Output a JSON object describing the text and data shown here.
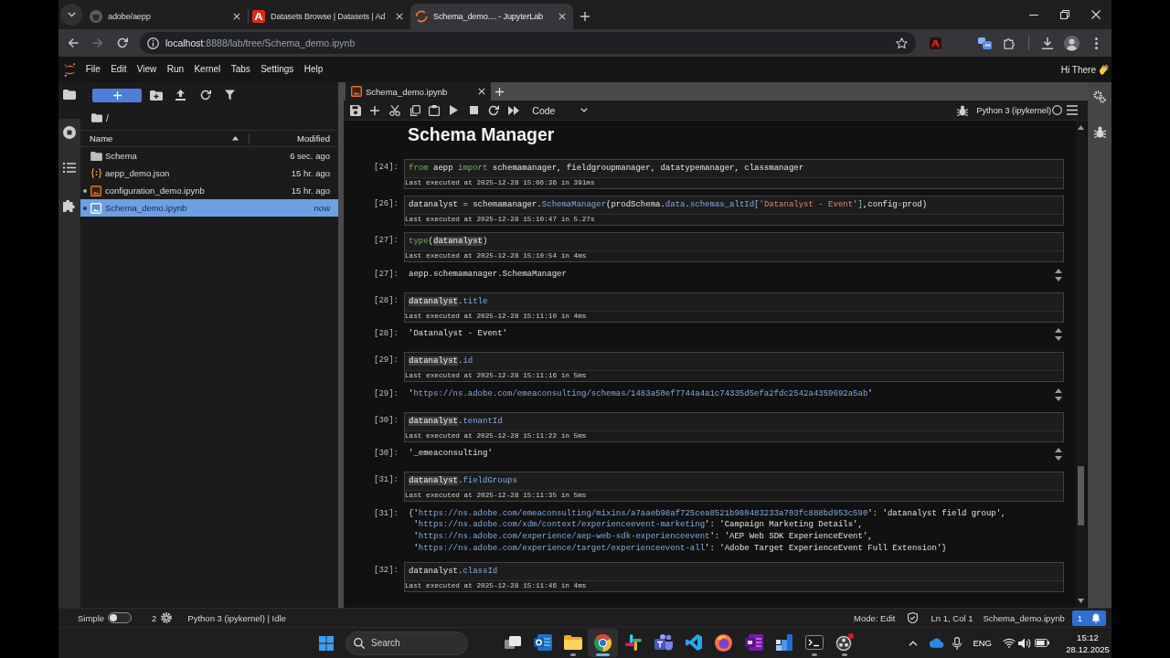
{
  "browser": {
    "tabs": [
      {
        "kind": "repo",
        "title": "adobe/aepp",
        "selected": false
      },
      {
        "kind": "cloud",
        "title": "Datasets Browse | Datasets | Ad",
        "selected": false
      },
      {
        "kind": "lab",
        "title": "Schema_demo.... - JupyterLab",
        "selected": true
      }
    ],
    "forward_disabled": true,
    "address": {
      "host": "localhost",
      "path": ":8888/lab/tree/Schema_demo.ipynb"
    }
  },
  "menu_bar": {
    "items": [
      "File",
      "Edit",
      "View",
      "Run",
      "Kernel",
      "Tabs",
      "Settings",
      "Help"
    ],
    "greeting": "Hi There"
  },
  "left_sidebar": {
    "items": [
      {
        "kind": "files",
        "selected": true
      },
      {
        "kind": "running",
        "selected": false
      },
      {
        "kind": "toc",
        "selected": false
      },
      {
        "kind": "extensions",
        "selected": false
      }
    ]
  },
  "file_browser": {
    "path": "/",
    "columns": [
      "Name",
      "Modified"
    ],
    "items": [
      {
        "kind": "folder",
        "name": "Schema",
        "modified": "6 sec. ago",
        "running": false,
        "selected": false
      },
      {
        "kind": "json",
        "name": "aepp_demo.json",
        "modified": "15 hr. ago",
        "running": false,
        "selected": false
      },
      {
        "kind": "notebook",
        "name": "configuration_demo.ipynb",
        "modified": "15 hr. ago",
        "running": true,
        "selected": false
      },
      {
        "kind": "notebook",
        "name": "Schema_demo.ipynb",
        "modified": "now",
        "running": true,
        "selected": true
      }
    ]
  },
  "notebook": {
    "tabs": [
      {
        "title": "Schema_demo.ipynb",
        "selected": true
      }
    ],
    "cell_type": "Code",
    "kernel": "Python 3 (ipykernel)",
    "kernel_busy": false,
    "heading": "Schema Manager",
    "cells": [
      {
        "prompt": "[24]:",
        "code": [
          {
            "kind": "keyword",
            "text": "from"
          },
          {
            "kind": "plain",
            "text": " aepp "
          },
          {
            "kind": "keyword",
            "text": "import"
          },
          {
            "kind": "plain",
            "text": " schemamanager, fieldgroupmanager, datatypemanager, classmanager"
          }
        ],
        "executed": "Last executed at 2025-12-28 15:06:36 in 391ms"
      },
      {
        "prompt": "[26]:",
        "code": [
          {
            "kind": "plain",
            "text": "datanalyst = schemamanager."
          },
          {
            "kind": "attribute",
            "text": "SchemaManager"
          },
          {
            "kind": "plain",
            "text": "(prodSchema."
          },
          {
            "kind": "attribute",
            "text": "data"
          },
          {
            "kind": "plain",
            "text": "."
          },
          {
            "kind": "attribute",
            "text": "schemas_altId"
          },
          {
            "kind": "bracket",
            "text": "["
          },
          {
            "kind": "string",
            "text": "'Datanalyst - Event'"
          },
          {
            "kind": "bracket",
            "text": "]"
          },
          {
            "kind": "plain",
            "text": ",config"
          },
          {
            "kind": "operator",
            "text": "="
          },
          {
            "kind": "plain",
            "text": "prod)"
          }
        ],
        "executed": "Last executed at 2025-12-28 15:10:47 in 5.27s"
      },
      {
        "prompt": "[27]:",
        "code": [
          {
            "kind": "builtin",
            "text": "type"
          },
          {
            "kind": "plain",
            "text": "("
          },
          {
            "kind": "match",
            "text": "datanalyst"
          },
          {
            "kind": "plain",
            "text": ")"
          }
        ],
        "executed": "Last executed at 2025-12-28 15:10:54 in 4ms",
        "output": {
          "prompt": "[27]:",
          "lines": [
            [
              {
                "kind": "plain",
                "text": "aepp.schemamanager.SchemaManager"
              }
            ]
          ],
          "scrollable": true
        }
      },
      {
        "prompt": "[28]:",
        "code": [
          {
            "kind": "match",
            "text": "datanalyst"
          },
          {
            "kind": "plain",
            "text": "."
          },
          {
            "kind": "attribute",
            "text": "title"
          }
        ],
        "executed": "Last executed at 2025-12-28 15:11:10 in 4ms",
        "output": {
          "prompt": "[28]:",
          "lines": [
            [
              {
                "kind": "plain",
                "text": "'Datanalyst - Event'"
              }
            ]
          ],
          "scrollable": true
        }
      },
      {
        "prompt": "[29]:",
        "code": [
          {
            "kind": "match",
            "text": "datanalyst"
          },
          {
            "kind": "plain",
            "text": "."
          },
          {
            "kind": "attribute",
            "text": "id"
          }
        ],
        "executed": "Last executed at 2025-12-28 15:11:16 in 5ms",
        "output": {
          "prompt": "[29]:",
          "lines": [
            [
              {
                "kind": "plain",
                "text": "'"
              },
              {
                "kind": "link",
                "text": "https://ns.adobe.com/emeaconsulting/schemas/1483a50ef7744a4a1c74335d5efa2fdc2542a4359692a5ab"
              },
              {
                "kind": "plain",
                "text": "'"
              }
            ]
          ],
          "scrollable": true
        }
      },
      {
        "prompt": "[30]:",
        "code": [
          {
            "kind": "match",
            "text": "datanalyst"
          },
          {
            "kind": "plain",
            "text": "."
          },
          {
            "kind": "attribute",
            "text": "tenantId"
          }
        ],
        "executed": "Last executed at 2025-12-28 15:11:22 in 5ms",
        "output": {
          "prompt": "[30]:",
          "lines": [
            [
              {
                "kind": "plain",
                "text": "'_emeaconsulting'"
              }
            ]
          ],
          "scrollable": true
        }
      },
      {
        "prompt": "[31]:",
        "code": [
          {
            "kind": "match",
            "text": "datanalyst"
          },
          {
            "kind": "plain",
            "text": "."
          },
          {
            "kind": "attribute",
            "text": "fieldGroups"
          }
        ],
        "executed": "Last executed at 2025-12-28 15:11:35 in 5ms",
        "output": {
          "prompt": "[31]:",
          "lines": [
            [
              {
                "kind": "plain",
                "text": "{'"
              },
              {
                "kind": "link",
                "text": "https://ns.adobe.com/emeaconsulting/mixins/a7aaeb98af725cea8521b980483233a703fc888bd953c590"
              },
              {
                "kind": "plain",
                "text": "': 'datanalyst field group',"
              }
            ],
            [
              {
                "kind": "plain",
                "text": " '"
              },
              {
                "kind": "link",
                "text": "https://ns.adobe.com/xdm/context/experienceevent-marketing"
              },
              {
                "kind": "plain",
                "text": "': 'Campaign Marketing Details',"
              }
            ],
            [
              {
                "kind": "plain",
                "text": " '"
              },
              {
                "kind": "link",
                "text": "https://ns.adobe.com/experience/aep-web-sdk-experienceevent"
              },
              {
                "kind": "plain",
                "text": "': 'AEP Web SDK ExperienceEvent',"
              }
            ],
            [
              {
                "kind": "plain",
                "text": " '"
              },
              {
                "kind": "link",
                "text": "https://ns.adobe.com/experience/target/experienceevent-all"
              },
              {
                "kind": "plain",
                "text": "': 'Adobe Target ExperienceEvent Full Extension'}"
              }
            ]
          ],
          "scrollable": false
        }
      },
      {
        "prompt": "[32]:",
        "code": [
          {
            "kind": "plain",
            "text": "datanalyst."
          },
          {
            "kind": "attribute",
            "text": "classId"
          }
        ],
        "executed": "Last executed at 2025-12-28 15:11:46 in 4ms"
      }
    ]
  },
  "status_bar": {
    "simple_mode": {
      "label": "Simple",
      "on": false
    },
    "kernel_count": "2",
    "kernel_status": "Python 3 (ipykernel) | Idle",
    "mode": "Mode: Edit",
    "cursor": "Ln 1, Col 1",
    "file": "Schema_demo.ipynb",
    "notifications": "1"
  },
  "taskbar": {
    "search": {
      "placeholder": "Search"
    },
    "apps": [
      {
        "kind": "mail",
        "running": false,
        "selected": false
      },
      {
        "kind": "files",
        "running": true,
        "selected": false
      },
      {
        "kind": "browser",
        "running": true,
        "selected": true
      },
      {
        "kind": "chat",
        "running": false,
        "selected": false
      },
      {
        "kind": "meetings",
        "running": false,
        "selected": false
      },
      {
        "kind": "editor",
        "running": false,
        "selected": false
      },
      {
        "kind": "web",
        "running": false,
        "selected": false
      },
      {
        "kind": "notes",
        "running": false,
        "selected": false
      },
      {
        "kind": "blocks",
        "running": false,
        "selected": false
      },
      {
        "kind": "terminal",
        "running": true,
        "selected": false
      },
      {
        "kind": "recorder",
        "running": true,
        "selected": false
      }
    ],
    "language": "ENG",
    "clock": {
      "time": "15:12",
      "date": "28.12.2025"
    }
  }
}
